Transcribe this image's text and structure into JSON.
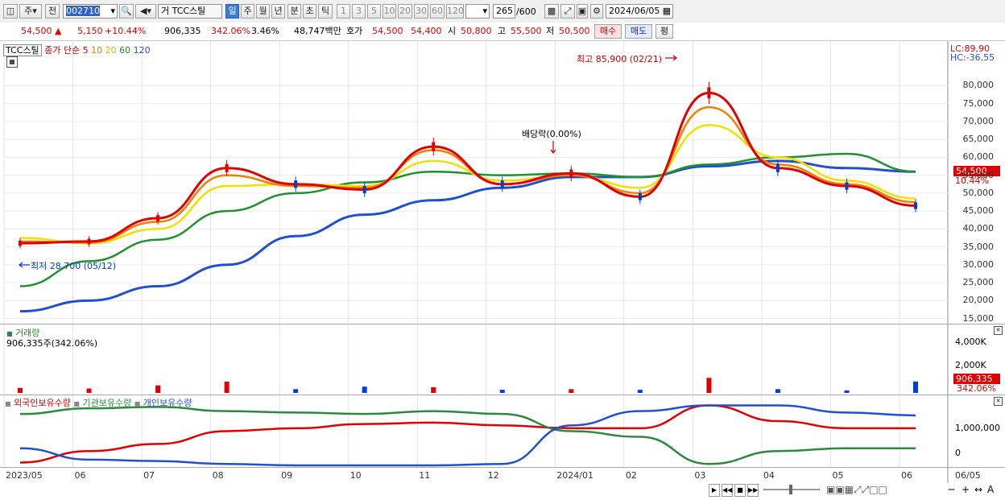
{
  "toolbar": {
    "market_label": "주",
    "prev_label": "전",
    "code": "002710",
    "name_prefix": "거",
    "name": "TCC스틸",
    "periods": [
      "일",
      "주",
      "월",
      "년",
      "분",
      "초",
      "틱"
    ],
    "numbers": [
      "1",
      "3",
      "5",
      "10",
      "20",
      "30",
      "60",
      "120"
    ],
    "count": "265",
    "total": "/600",
    "date": "2024/06/05"
  },
  "quote": {
    "price": "54,500",
    "change": "5,150",
    "change_pct": "+10.44%",
    "volume": "906,335",
    "volume_pct": "342.06%",
    "turnover": "3.46%",
    "amount": "48,747백만",
    "ask_label": "호가",
    "ask": "54,500",
    "bid": "54,400",
    "open_label": "시",
    "open": "50,800",
    "high_label": "고",
    "high": "55,500",
    "low_label": "저",
    "low": "50,500",
    "buy_label": "매수",
    "sell_label": "매도",
    "eval_label": "평"
  },
  "price_panel": {
    "legend_name": "TCC스틸",
    "legend_ma": "종가 단순",
    "ma_periods": [
      "5",
      "10",
      "20",
      "60",
      "120"
    ],
    "lc": "LC:89,90",
    "hc": "HC:-36,55",
    "high_note": "최고 85,900 (02/21)",
    "low_note": "최저 28,700 (05/12)",
    "dividend_note": "배당락(0.00%)",
    "price_tag": "54,500",
    "pct_tag": "10.44%",
    "yticks": [
      "80,000",
      "75,000",
      "70,000",
      "65,000",
      "60,000",
      "55,000",
      "50,000",
      "45,000",
      "40,000",
      "35,000",
      "30,000",
      "25,000",
      "20,000",
      "15,000"
    ]
  },
  "volume_panel": {
    "title": "거래량",
    "value": "906,335주(342.06%)",
    "yticks": [
      "4,000K",
      "2,000K",
      "0"
    ],
    "tag_value": "906,335",
    "tag_pct": "342.06%"
  },
  "holder_panel": {
    "legend_foreign": "외국인보유수량",
    "legend_inst": "기관보유수량",
    "legend_indiv": "개인보유수량",
    "yticks": [
      "1,000,000",
      "0"
    ]
  },
  "xaxis": [
    "2023/05",
    "06",
    "07",
    "08",
    "09",
    "10",
    "11",
    "12",
    "2024/01",
    "02",
    "03",
    "04",
    "05",
    "06",
    "06/05"
  ],
  "colors": {
    "ma5": "#e00000",
    "ma10": "#f08000",
    "ma20": "#f0e000",
    "ma60": "#209030",
    "ma120": "#2050d0",
    "up": "#e00000",
    "down": "#0040d0"
  },
  "chart_data": [
    {
      "type": "line",
      "title": "TCC스틸",
      "ylabel": "",
      "ylim": [
        14000,
        90000
      ],
      "x": [
        "2023/05",
        "2023/06",
        "2023/07",
        "2023/08",
        "2023/09",
        "2023/10",
        "2023/11",
        "2023/12",
        "2024/01",
        "2024/02",
        "2024/03",
        "2024/04",
        "2024/05",
        "2024/06"
      ],
      "series": [
        {
          "name": "5",
          "values": [
            36000,
            36500,
            43000,
            57000,
            52500,
            51000,
            63000,
            52500,
            55500,
            49000,
            78000,
            57000,
            52000,
            46500
          ]
        },
        {
          "name": "10",
          "values": [
            36500,
            36200,
            42000,
            55000,
            52000,
            51500,
            62000,
            52500,
            55000,
            50000,
            74000,
            58000,
            52500,
            47500
          ]
        },
        {
          "name": "20",
          "values": [
            37500,
            36000,
            40000,
            52000,
            52500,
            52000,
            59000,
            53500,
            55000,
            51500,
            69000,
            60000,
            53500,
            48500
          ]
        },
        {
          "name": "60",
          "values": [
            24000,
            31000,
            37000,
            45000,
            50000,
            53000,
            56000,
            55000,
            55500,
            54500,
            58000,
            60000,
            61000,
            56000
          ]
        },
        {
          "name": "120",
          "values": [
            17000,
            20000,
            24000,
            30000,
            38000,
            44000,
            48000,
            51500,
            54500,
            54500,
            57500,
            59000,
            57000,
            56000
          ]
        }
      ]
    },
    {
      "type": "bar",
      "title": "거래량",
      "ylim": [
        0,
        5000000
      ],
      "x": [
        "2023/05",
        "2023/06",
        "2023/07",
        "2023/08",
        "2023/09",
        "2023/10",
        "2023/11",
        "2023/12",
        "2024/01",
        "2024/02",
        "2024/03",
        "2024/04",
        "2024/05",
        "2024/06"
      ],
      "values": [
        400000,
        350000,
        600000,
        900000,
        300000,
        500000,
        450000,
        250000,
        300000,
        250000,
        1200000,
        300000,
        200000,
        906335
      ]
    },
    {
      "type": "line",
      "title": "",
      "ylim": [
        -300000,
        1900000
      ],
      "x": [
        "2023/05",
        "2023/06",
        "2023/07",
        "2023/08",
        "2023/09",
        "2023/10",
        "2023/11",
        "2023/12",
        "2024/01",
        "2024/02",
        "2024/03",
        "2024/04",
        "2024/05",
        "2024/06"
      ],
      "series": [
        {
          "name": "외국인보유수량",
          "values": [
            -200000,
            200000,
            450000,
            900000,
            1000000,
            1150000,
            1200000,
            1100000,
            1000000,
            1000000,
            1800000,
            1250000,
            1000000,
            1000000
          ]
        },
        {
          "name": "기관보유수량",
          "values": [
            1500000,
            1700000,
            1750000,
            1600000,
            1550000,
            1500000,
            1600000,
            1500000,
            900000,
            700000,
            -250000,
            200000,
            300000,
            300000
          ]
        },
        {
          "name": "개인보유수량",
          "values": [
            300000,
            -100000,
            -150000,
            -250000,
            -300000,
            -300000,
            -300000,
            -250000,
            1100000,
            1600000,
            1800000,
            1800000,
            1550000,
            1450000
          ]
        }
      ]
    }
  ]
}
